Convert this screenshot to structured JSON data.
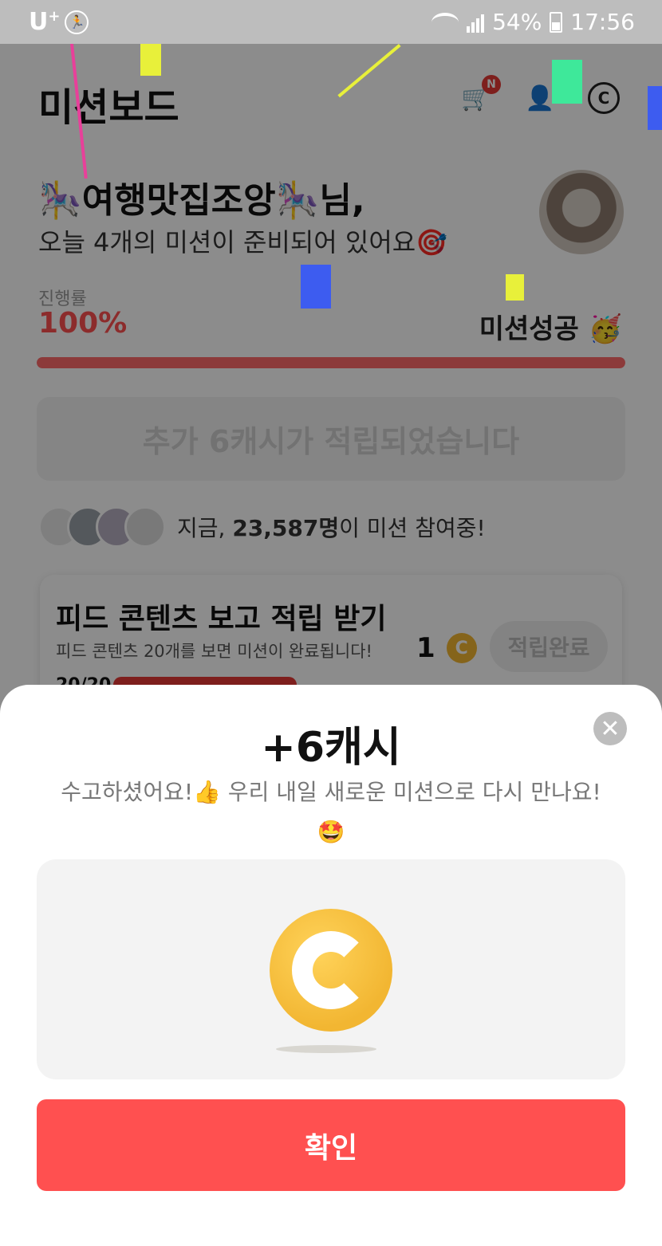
{
  "status_bar": {
    "carrier": "U",
    "carrier_sup": "+",
    "battery": "54%",
    "time": "17:56"
  },
  "header": {
    "title": "미션보드",
    "cart_badge": "N"
  },
  "greeting": {
    "name": "🎠여행맛집조앙🎠님,",
    "subtitle": "오늘 4개의 미션이 준비되어 있어요🎯"
  },
  "progress": {
    "label": "진행률",
    "value_text": "100%",
    "status": "미션성공 🥳",
    "fill_fraction": 1.0
  },
  "banner": {
    "text": "추가 6캐시가 적립되었습니다"
  },
  "participants": {
    "prefix": "지금, ",
    "count": "23,587명",
    "suffix": "이 미션 참여중!"
  },
  "mission": {
    "title": "피드 콘텐츠 보고 적립 받기",
    "description": "피드 콘텐츠 20개를 보면 미션이 완료됩니다!",
    "reward": "1",
    "coin_symbol": "C",
    "button": "적립완료",
    "count": "20/20"
  },
  "sheet": {
    "title": "+6캐시",
    "close_symbol": "✕",
    "message_line1": "수고하셨어요!👍 우리 내일 새로운 미션으로 다시 만나요!",
    "message_line2": "🤩",
    "confirm": "확인"
  },
  "colors": {
    "accent": "#ff5050",
    "coin": "#f2b632",
    "panel": "#f3f3f3"
  }
}
